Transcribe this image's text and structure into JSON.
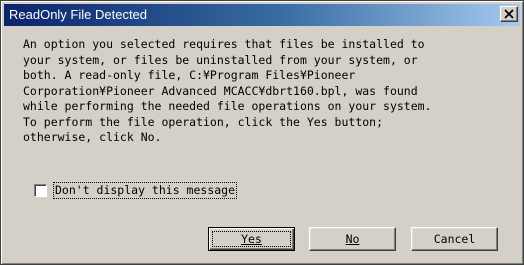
{
  "window": {
    "title": "ReadOnly File Detected"
  },
  "message": "An option you selected requires that files be installed to\nyour system, or files be uninstalled from your system, or\nboth. A read-only file, C:¥Program Files¥Pioneer\nCorporation¥Pioneer Advanced MCACC¥dbrt160.bpl, was found\nwhile performing the needed file operations on your system.\nTo perform the file operation, click the Yes button;\notherwise, click No.",
  "checkbox": {
    "label": "Don't display this message",
    "checked": false
  },
  "buttons": {
    "yes": "Yes",
    "no": "No",
    "cancel": "Cancel"
  }
}
